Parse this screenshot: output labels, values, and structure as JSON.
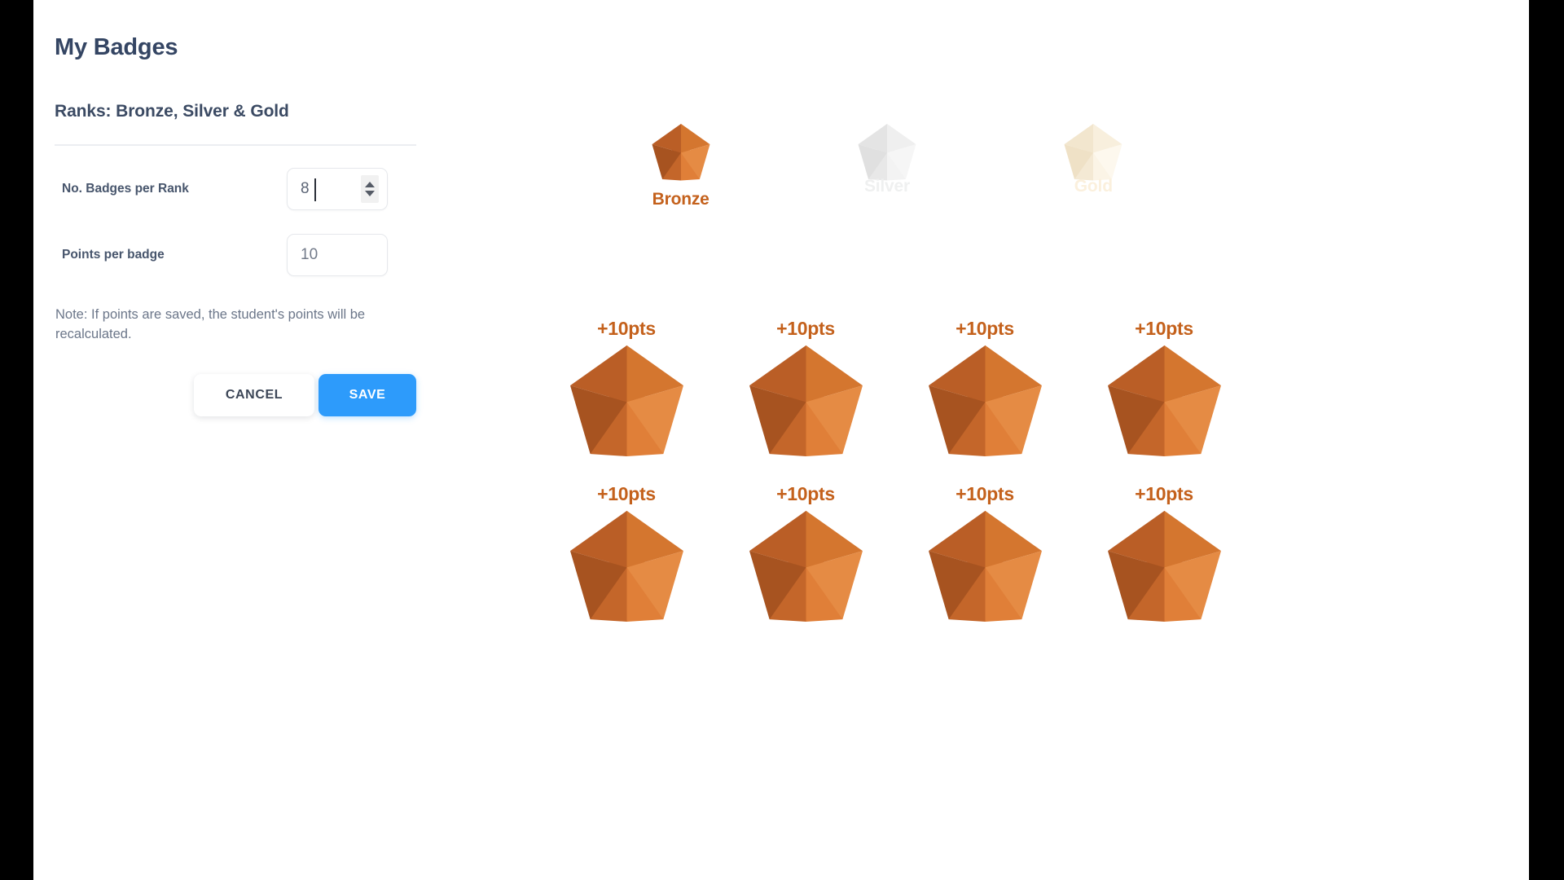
{
  "page": {
    "title": "My Badges",
    "section_title": "Ranks: Bronze, Silver & Gold"
  },
  "form": {
    "fields": [
      {
        "label": "No. Badges per Rank",
        "value": "8",
        "placeholder": "",
        "has_stepper": true,
        "focused": true
      },
      {
        "label": "Points per badge",
        "value": "",
        "placeholder": "10",
        "has_stepper": false,
        "focused": false
      }
    ],
    "note": "Note: If points are saved, the student's points will be recalculated.",
    "cancel_label": "CANCEL",
    "save_label": "SAVE"
  },
  "ranks": [
    {
      "name": "Bronze",
      "state": "active",
      "star_icon": "star-icon"
    },
    {
      "name": "Silver",
      "state": "inactive",
      "star_icon": "star-icon"
    },
    {
      "name": "Gold",
      "state": "inactive",
      "star_icon": "star-icon"
    }
  ],
  "badges": {
    "count": 8,
    "points_label": "+10pts",
    "items": [
      {
        "points_label": "+10pts",
        "star_icon": "star-icon"
      },
      {
        "points_label": "+10pts",
        "star_icon": "star-icon"
      },
      {
        "points_label": "+10pts",
        "star_icon": "star-icon"
      },
      {
        "points_label": "+10pts",
        "star_icon": "star-icon"
      },
      {
        "points_label": "+10pts",
        "star_icon": "star-icon"
      },
      {
        "points_label": "+10pts",
        "star_icon": "star-icon"
      },
      {
        "points_label": "+10pts",
        "star_icon": "star-icon"
      },
      {
        "points_label": "+10pts",
        "star_icon": "star-icon"
      }
    ]
  },
  "colors": {
    "accent_blue": "#2d9bfb",
    "bronze": "#d97c36",
    "bronze_dark": "#b05a24",
    "bronze_text": "#c4611c",
    "silver": "#ededed",
    "gold": "#f8efdd",
    "heading": "#344563",
    "label": "#47556c",
    "note": "#6b7689",
    "divider": "#eceef1"
  }
}
